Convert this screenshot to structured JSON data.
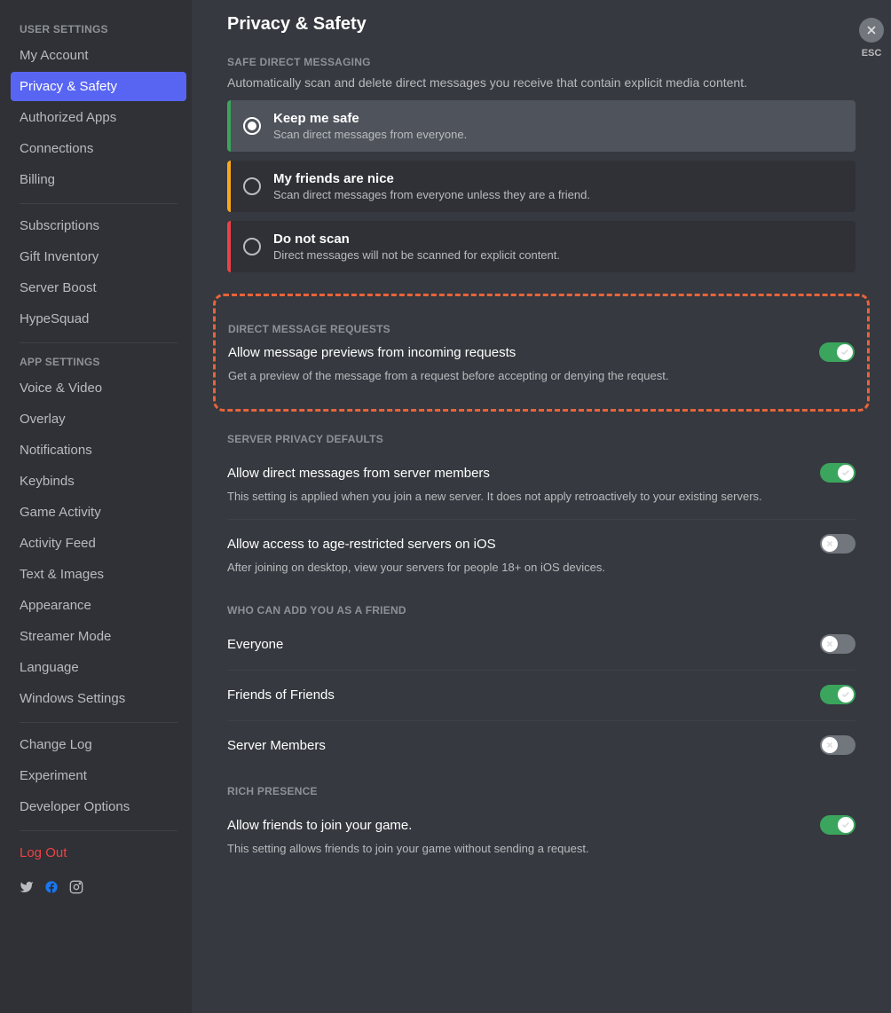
{
  "sidebar": {
    "userSettingsHeader": "USER SETTINGS",
    "appSettingsHeader": "APP SETTINGS",
    "groups": {
      "user": [
        "My Account",
        "Privacy & Safety",
        "Authorized Apps",
        "Connections",
        "Billing"
      ],
      "sub": [
        "Subscriptions",
        "Gift Inventory",
        "Server Boost",
        "HypeSquad"
      ],
      "app": [
        "Voice & Video",
        "Overlay",
        "Notifications",
        "Keybinds",
        "Game Activity",
        "Activity Feed",
        "Text & Images",
        "Appearance",
        "Streamer Mode",
        "Language",
        "Windows Settings"
      ],
      "misc": [
        "Change Log",
        "Experiment",
        "Developer Options"
      ],
      "logout": "Log Out"
    }
  },
  "close": {
    "label": "ESC"
  },
  "page": {
    "title": "Privacy & Safety",
    "safeDM": {
      "header": "SAFE DIRECT MESSAGING",
      "desc": "Automatically scan and delete direct messages you receive that contain explicit media content.",
      "options": [
        {
          "title": "Keep me safe",
          "desc": "Scan direct messages from everyone."
        },
        {
          "title": "My friends are nice",
          "desc": "Scan direct messages from everyone unless they are a friend."
        },
        {
          "title": "Do not scan",
          "desc": "Direct messages will not be scanned for explicit content."
        }
      ]
    },
    "dmRequests": {
      "header": "DIRECT MESSAGE REQUESTS",
      "title": "Allow message previews from incoming requests",
      "desc": "Get a preview of the message from a request before accepting or denying the request.",
      "on": true
    },
    "serverPrivacy": {
      "header": "SERVER PRIVACY DEFAULTS",
      "rows": [
        {
          "title": "Allow direct messages from server members",
          "desc": "This setting is applied when you join a new server. It does not apply retroactively to your existing servers.",
          "on": true
        },
        {
          "title": "Allow access to age-restricted servers on iOS",
          "desc": "After joining on desktop, view your servers for people 18+ on iOS devices.",
          "on": false
        }
      ]
    },
    "friendAdd": {
      "header": "WHO CAN ADD YOU AS A FRIEND",
      "rows": [
        {
          "title": "Everyone",
          "on": false
        },
        {
          "title": "Friends of Friends",
          "on": true
        },
        {
          "title": "Server Members",
          "on": false
        }
      ]
    },
    "richPresence": {
      "header": "RICH PRESENCE",
      "title": "Allow friends to join your game.",
      "desc": "This setting allows friends to join your game without sending a request.",
      "on": true
    }
  }
}
